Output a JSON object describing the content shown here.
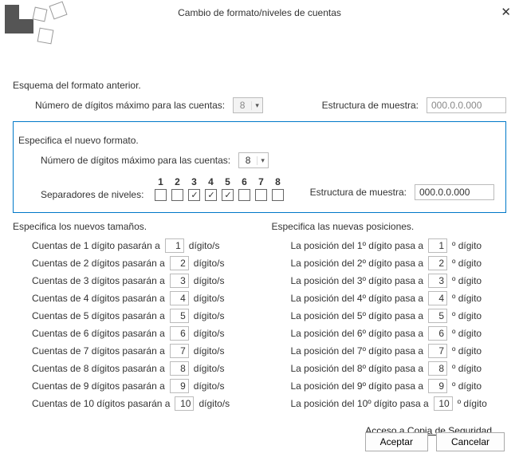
{
  "window": {
    "title": "Cambio de formato/niveles de cuentas"
  },
  "previous": {
    "label": "Esquema del formato anterior.",
    "max_digits_label": "Número de dígitos máximo para las cuentas:",
    "max_digits_value": "8",
    "sample_label": "Estructura de muestra:",
    "sample_value": "000.0.0.000"
  },
  "newfmt": {
    "label": "Especifica el nuevo formato.",
    "max_digits_label": "Número de dígitos máximo para las cuentas:",
    "max_digits_value": "8",
    "sep_label": "Separadores de niveles:",
    "sep_numbers": [
      "1",
      "2",
      "3",
      "4",
      "5",
      "6",
      "7",
      "8"
    ],
    "sep_checked": [
      false,
      false,
      true,
      true,
      true,
      false,
      false,
      false
    ],
    "sample_label": "Estructura de muestra:",
    "sample_value": "000.0.0.000"
  },
  "sizes": {
    "header": "Especifica los nuevos tamaños.",
    "rows": [
      {
        "pre": "Cuentas de 1 dígito pasarán a",
        "val": "1",
        "post": "dígito/s"
      },
      {
        "pre": "Cuentas de 2 dígitos pasarán a",
        "val": "2",
        "post": "dígito/s"
      },
      {
        "pre": "Cuentas de 3 dígitos pasarán a",
        "val": "3",
        "post": "dígito/s"
      },
      {
        "pre": "Cuentas de 4 dígitos pasarán a",
        "val": "4",
        "post": "dígito/s"
      },
      {
        "pre": "Cuentas de 5 dígitos pasarán a",
        "val": "5",
        "post": "dígito/s"
      },
      {
        "pre": "Cuentas de 6 dígitos pasarán a",
        "val": "6",
        "post": "dígito/s"
      },
      {
        "pre": "Cuentas de 7 dígitos pasarán a",
        "val": "7",
        "post": "dígito/s"
      },
      {
        "pre": "Cuentas de 8 dígitos pasarán a",
        "val": "8",
        "post": "dígito/s"
      },
      {
        "pre": "Cuentas de 9 dígitos pasarán a",
        "val": "9",
        "post": "dígito/s"
      },
      {
        "pre": "Cuentas de 10 dígitos pasarán a",
        "val": "10",
        "post": "dígito/s"
      }
    ]
  },
  "positions": {
    "header": "Especifica las nuevas posiciones.",
    "rows": [
      {
        "pre": "La posición del 1º dígito pasa a",
        "val": "1",
        "post": "º dígito"
      },
      {
        "pre": "La posición del 2º dígito pasa a",
        "val": "2",
        "post": "º dígito"
      },
      {
        "pre": "La posición del 3º dígito pasa a",
        "val": "3",
        "post": "º dígito"
      },
      {
        "pre": "La posición del 4º dígito pasa a",
        "val": "4",
        "post": "º dígito"
      },
      {
        "pre": "La posición del 5º dígito pasa a",
        "val": "5",
        "post": "º dígito"
      },
      {
        "pre": "La posición del 6º dígito pasa a",
        "val": "6",
        "post": "º dígito"
      },
      {
        "pre": "La posición del 7º dígito pasa a",
        "val": "7",
        "post": "º dígito"
      },
      {
        "pre": "La posición del 8º dígito pasa a",
        "val": "8",
        "post": "º dígito"
      },
      {
        "pre": "La posición del 9º dígito pasa a",
        "val": "9",
        "post": "º dígito"
      },
      {
        "pre": "La posición del 10º dígito pasa a",
        "val": "10",
        "post": "º dígito"
      }
    ]
  },
  "backup_link": "Acceso a Copia de Seguridad",
  "buttons": {
    "ok": "Aceptar",
    "cancel": "Cancelar"
  },
  "glyphs": {
    "check": "✓",
    "caret": "▾",
    "close": "✕"
  }
}
